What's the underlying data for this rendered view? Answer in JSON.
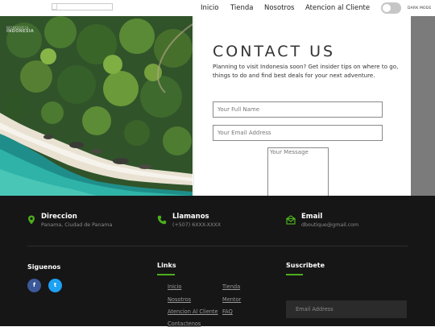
{
  "nav": {
    "links": [
      "Inicio",
      "Tienda",
      "Nosotros",
      "Atencion al Cliente"
    ],
    "dark_mode_label": "DARK MODE",
    "dark_mode_on": false
  },
  "hero": {
    "title": "CONTACT US",
    "description": "Planning to visit Indonesia soon? Get insider tips on where to go, things to do and find best deals for your next adventure.",
    "watermark_line1": "WONDERFUL",
    "watermark_line2": "INDONESIA",
    "form": {
      "name_placeholder": "Your Full Name",
      "email_placeholder": "Your Email Address",
      "message_placeholder": "Your Message"
    }
  },
  "footer": {
    "info": [
      {
        "title": "Direccion",
        "sub": "Panama, Ciudad de Panama",
        "icon": "location-pin-icon"
      },
      {
        "title": "Llamanos",
        "sub": "(+507) 6XXX-XXXX",
        "icon": "phone-icon"
      },
      {
        "title": "Email",
        "sub": "dboutique@gmail.com",
        "icon": "envelope-icon"
      }
    ],
    "follow_title": "Siguenos",
    "social": [
      "f",
      "t"
    ],
    "links_title": "Links",
    "links_col1": [
      "Inicio",
      "Nosotros",
      "Atencion Al Cliente",
      "Contactenos"
    ],
    "links_col2": [
      "Tienda",
      "Mentor",
      "FAQ"
    ],
    "subscribe_title": "Suscribete",
    "subscribe_placeholder": "Email Address",
    "colors": {
      "accent": "#4caf1c",
      "facebook": "#3b5998",
      "twitter": "#1da1f2",
      "background": "#161616"
    }
  }
}
